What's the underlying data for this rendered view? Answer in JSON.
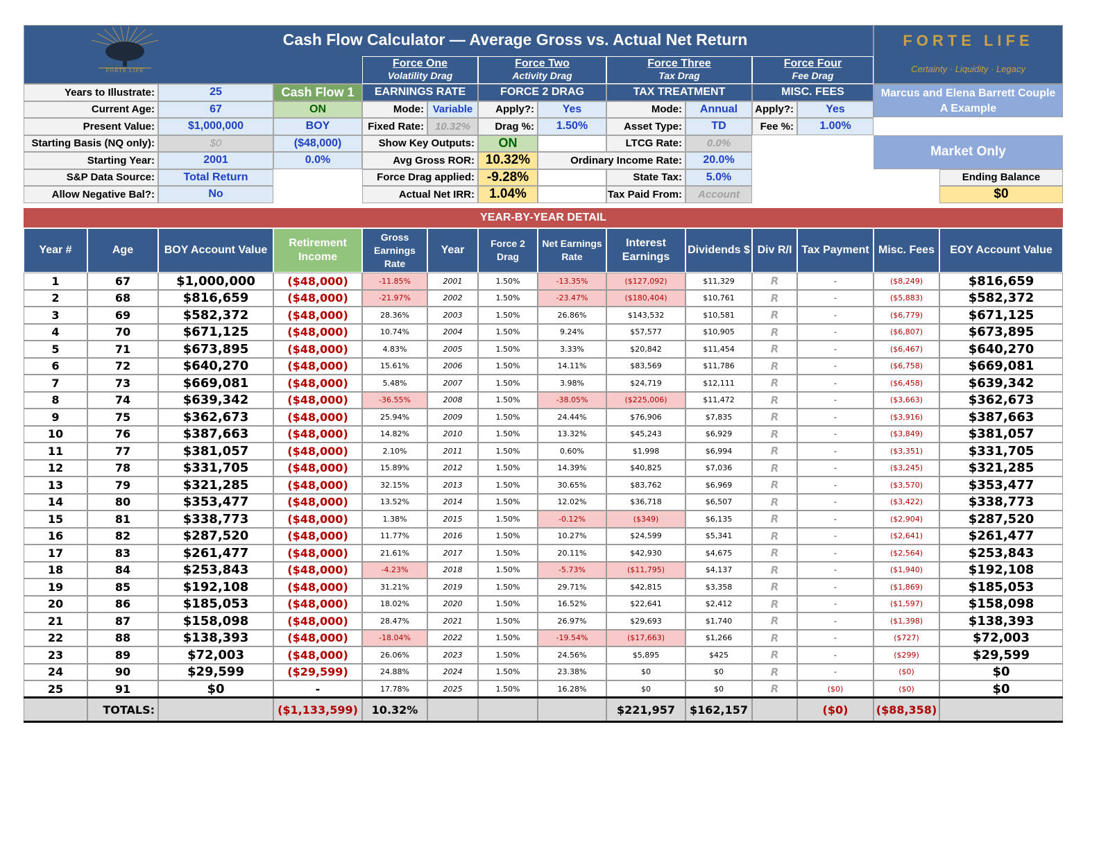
{
  "header": {
    "title": "Cash Flow Calculator — Average Gross vs. Actual Net Return",
    "brand": "FORTE LIFE",
    "tagline": "Certainty · Liquidity · Legacy",
    "logo_text": "FORTE LIFE",
    "client_line1": "Marcus and Elena Barrett Couple",
    "client_line2": "A Example"
  },
  "forces": [
    {
      "name": "Force One",
      "sub": "Volatility Drag",
      "section": "EARNINGS RATE"
    },
    {
      "name": "Force Two",
      "sub": "Activity Drag",
      "section": "FORCE 2 DRAG"
    },
    {
      "name": "Force Three",
      "sub": "Tax Drag",
      "section": "TAX TREATMENT"
    },
    {
      "name": "Force Four",
      "sub": "Fee Drag",
      "section": "MISC. FEES"
    }
  ],
  "inputs": {
    "years_label": "Years to Illustrate:",
    "years": "25",
    "age_label": "Current Age:",
    "age": "67",
    "pv_label": "Present Value:",
    "pv": "$1,000,000",
    "basis_label": "Starting Basis (NQ only):",
    "basis": "$0",
    "start_year_label": "Starting Year:",
    "start_year": "2001",
    "sp_label": "S&P Data Source:",
    "sp": "Total Return",
    "neg_label": "Allow Negative Bal?:",
    "neg": "No"
  },
  "cash_flow": {
    "title": "Cash Flow 1",
    "status": "ON",
    "timing": "BOY",
    "amount": "($48,000)",
    "rate": "0.0%"
  },
  "earnings": {
    "mode_label": "Mode:",
    "mode": "Variable",
    "fixed_label": "Fixed Rate:",
    "fixed": "10.32%",
    "show_label": "Show Key Outputs:",
    "show": "ON",
    "avg_label": "Avg Gross ROR:",
    "avg": "10.32%",
    "drag_label": "Force Drag applied:",
    "drag": "-9.28%",
    "irr_label": "Actual Net IRR:",
    "irr": "1.04%"
  },
  "force2": {
    "apply_label": "Apply?:",
    "apply": "Yes",
    "drag_label": "Drag %:",
    "drag": "1.50%"
  },
  "tax": {
    "mode_label": "Mode:",
    "mode": "Annual",
    "asset_label": "Asset Type:",
    "asset": "TD",
    "ltcg_label": "LTCG Rate:",
    "ltcg": "0.0%",
    "oir_label": "Ordinary Income Rate:",
    "oir": "20.0%",
    "state_label": "State Tax:",
    "state": "5.0%",
    "paid_label": "Tax Paid From:",
    "paid": "Account"
  },
  "fees": {
    "apply_label": "Apply?:",
    "apply": "Yes",
    "fee_label": "Fee %:",
    "fee": "1.00%"
  },
  "market": {
    "title": "Market Only",
    "ending_label": "Ending Balance",
    "ending": "$0"
  },
  "detail": {
    "banner": "YEAR-BY-YEAR DETAIL",
    "headers": [
      "Year #",
      "Age",
      "BOY Account Value",
      "Retirement Income",
      "Gross Earnings Rate",
      "Year",
      "Force 2 Drag",
      "Net Earnings Rate",
      "Interest Earnings",
      "Dividends $",
      "Div R/I",
      "Tax Payment",
      "Misc. Fees",
      "EOY Account Value"
    ],
    "rows": [
      [
        "1",
        "67",
        "$1,000,000",
        "($48,000)",
        "-11.85%",
        "2001",
        "1.50%",
        "-13.35%",
        "($127,092)",
        "$11,329",
        "R",
        "-",
        "($8,249)",
        "$816,659"
      ],
      [
        "2",
        "68",
        "$816,659",
        "($48,000)",
        "-21.97%",
        "2002",
        "1.50%",
        "-23.47%",
        "($180,404)",
        "$10,761",
        "R",
        "-",
        "($5,883)",
        "$582,372"
      ],
      [
        "3",
        "69",
        "$582,372",
        "($48,000)",
        "28.36%",
        "2003",
        "1.50%",
        "26.86%",
        "$143,532",
        "$10,581",
        "R",
        "-",
        "($6,779)",
        "$671,125"
      ],
      [
        "4",
        "70",
        "$671,125",
        "($48,000)",
        "10.74%",
        "2004",
        "1.50%",
        "9.24%",
        "$57,577",
        "$10,905",
        "R",
        "-",
        "($6,807)",
        "$673,895"
      ],
      [
        "5",
        "71",
        "$673,895",
        "($48,000)",
        "4.83%",
        "2005",
        "1.50%",
        "3.33%",
        "$20,842",
        "$11,454",
        "R",
        "-",
        "($6,467)",
        "$640,270"
      ],
      [
        "6",
        "72",
        "$640,270",
        "($48,000)",
        "15.61%",
        "2006",
        "1.50%",
        "14.11%",
        "$83,569",
        "$11,786",
        "R",
        "-",
        "($6,758)",
        "$669,081"
      ],
      [
        "7",
        "73",
        "$669,081",
        "($48,000)",
        "5.48%",
        "2007",
        "1.50%",
        "3.98%",
        "$24,719",
        "$12,111",
        "R",
        "-",
        "($6,458)",
        "$639,342"
      ],
      [
        "8",
        "74",
        "$639,342",
        "($48,000)",
        "-36.55%",
        "2008",
        "1.50%",
        "-38.05%",
        "($225,006)",
        "$11,472",
        "R",
        "-",
        "($3,663)",
        "$362,673"
      ],
      [
        "9",
        "75",
        "$362,673",
        "($48,000)",
        "25.94%",
        "2009",
        "1.50%",
        "24.44%",
        "$76,906",
        "$7,835",
        "R",
        "-",
        "($3,916)",
        "$387,663"
      ],
      [
        "10",
        "76",
        "$387,663",
        "($48,000)",
        "14.82%",
        "2010",
        "1.50%",
        "13.32%",
        "$45,243",
        "$6,929",
        "R",
        "-",
        "($3,849)",
        "$381,057"
      ],
      [
        "11",
        "77",
        "$381,057",
        "($48,000)",
        "2.10%",
        "2011",
        "1.50%",
        "0.60%",
        "$1,998",
        "$6,994",
        "R",
        "-",
        "($3,351)",
        "$331,705"
      ],
      [
        "12",
        "78",
        "$331,705",
        "($48,000)",
        "15.89%",
        "2012",
        "1.50%",
        "14.39%",
        "$40,825",
        "$7,036",
        "R",
        "-",
        "($3,245)",
        "$321,285"
      ],
      [
        "13",
        "79",
        "$321,285",
        "($48,000)",
        "32.15%",
        "2013",
        "1.50%",
        "30.65%",
        "$83,762",
        "$6,969",
        "R",
        "-",
        "($3,570)",
        "$353,477"
      ],
      [
        "14",
        "80",
        "$353,477",
        "($48,000)",
        "13.52%",
        "2014",
        "1.50%",
        "12.02%",
        "$36,718",
        "$6,507",
        "R",
        "-",
        "($3,422)",
        "$338,773"
      ],
      [
        "15",
        "81",
        "$338,773",
        "($48,000)",
        "1.38%",
        "2015",
        "1.50%",
        "-0.12%",
        "($349)",
        "$6,135",
        "R",
        "-",
        "($2,904)",
        "$287,520"
      ],
      [
        "16",
        "82",
        "$287,520",
        "($48,000)",
        "11.77%",
        "2016",
        "1.50%",
        "10.27%",
        "$24,599",
        "$5,341",
        "R",
        "-",
        "($2,641)",
        "$261,477"
      ],
      [
        "17",
        "83",
        "$261,477",
        "($48,000)",
        "21.61%",
        "2017",
        "1.50%",
        "20.11%",
        "$42,930",
        "$4,675",
        "R",
        "-",
        "($2,564)",
        "$253,843"
      ],
      [
        "18",
        "84",
        "$253,843",
        "($48,000)",
        "-4.23%",
        "2018",
        "1.50%",
        "-5.73%",
        "($11,795)",
        "$4,137",
        "R",
        "-",
        "($1,940)",
        "$192,108"
      ],
      [
        "19",
        "85",
        "$192,108",
        "($48,000)",
        "31.21%",
        "2019",
        "1.50%",
        "29.71%",
        "$42,815",
        "$3,358",
        "R",
        "-",
        "($1,869)",
        "$185,053"
      ],
      [
        "20",
        "86",
        "$185,053",
        "($48,000)",
        "18.02%",
        "2020",
        "1.50%",
        "16.52%",
        "$22,641",
        "$2,412",
        "R",
        "-",
        "($1,597)",
        "$158,098"
      ],
      [
        "21",
        "87",
        "$158,098",
        "($48,000)",
        "28.47%",
        "2021",
        "1.50%",
        "26.97%",
        "$29,693",
        "$1,740",
        "R",
        "-",
        "($1,398)",
        "$138,393"
      ],
      [
        "22",
        "88",
        "$138,393",
        "($48,000)",
        "-18.04%",
        "2022",
        "1.50%",
        "-19.54%",
        "($17,663)",
        "$1,266",
        "R",
        "-",
        "($727)",
        "$72,003"
      ],
      [
        "23",
        "89",
        "$72,003",
        "($48,000)",
        "26.06%",
        "2023",
        "1.50%",
        "24.56%",
        "$5,895",
        "$425",
        "R",
        "-",
        "($299)",
        "$29,599"
      ],
      [
        "24",
        "90",
        "$29,599",
        "($29,599)",
        "24.88%",
        "2024",
        "1.50%",
        "23.38%",
        "$0",
        "$0",
        "R",
        "-",
        "($0)",
        "$0"
      ],
      [
        "25",
        "91",
        "$0",
        "-",
        "17.78%",
        "2025",
        "1.50%",
        "16.28%",
        "$0",
        "$0",
        "R",
        "($0)",
        "($0)",
        "$0"
      ]
    ],
    "totals": [
      "",
      "TOTALS:",
      "",
      "($1,133,599)",
      "10.32%",
      "",
      "",
      "",
      "$221,957",
      "$162,157",
      "",
      "($0)",
      "($88,358)",
      ""
    ]
  },
  "colors": {
    "navy": "#375b8d",
    "red_banner": "#c0504d",
    "negative": "#b00000",
    "gold": "#c9a045"
  }
}
